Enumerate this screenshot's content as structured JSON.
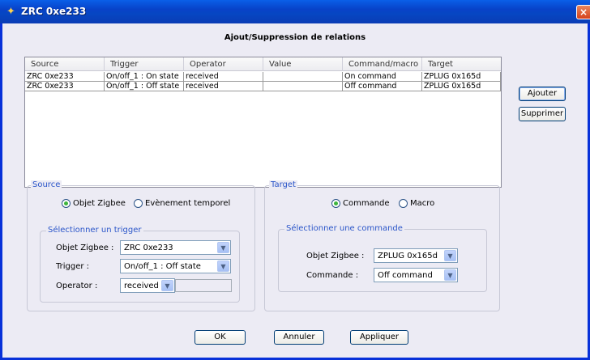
{
  "window": {
    "title": "ZRC 0xe233",
    "close_symbol": "×"
  },
  "heading": "Ajout/Suppression de relations",
  "table": {
    "columns": [
      "Source",
      "Trigger",
      "Operator",
      "Value",
      "Command/macro",
      "Target"
    ],
    "rows": [
      [
        "ZRC 0xe233",
        "On/off_1 : On state",
        "received",
        "",
        "On command",
        "ZPLUG 0x165d"
      ],
      [
        "ZRC 0xe233",
        "On/off_1 : Off state",
        "received",
        "",
        "Off command",
        "ZPLUG 0x165d"
      ]
    ]
  },
  "side_buttons": {
    "add": "Ajouter",
    "remove": "Supprimer"
  },
  "source": {
    "legend": "Source",
    "radio_zigbee": "Objet Zigbee",
    "radio_temporal": "Evènement temporel",
    "trigger_group": {
      "legend": "Sélectionner un trigger",
      "object_label": "Objet Zigbee :",
      "object_value": "ZRC 0xe233",
      "trigger_label": "Trigger :",
      "trigger_value": "On/off_1 : Off state",
      "operator_label": "Operator :",
      "operator_value": "received"
    }
  },
  "target": {
    "legend": "Target",
    "radio_command": "Commande",
    "radio_macro": "Macro",
    "command_group": {
      "legend": "Sélectionner une commande",
      "object_label": "Objet Zigbee :",
      "object_value": "ZPLUG 0x165d",
      "command_label": "Commande :",
      "command_value": "Off command"
    }
  },
  "footer": {
    "ok": "OK",
    "cancel": "Annuler",
    "apply": "Appliquer"
  },
  "colors": {
    "titlebar": "#0842c8",
    "legend": "#2b56c9",
    "radio_selected": "#3db43d",
    "client_bg": "#ecebf4"
  }
}
